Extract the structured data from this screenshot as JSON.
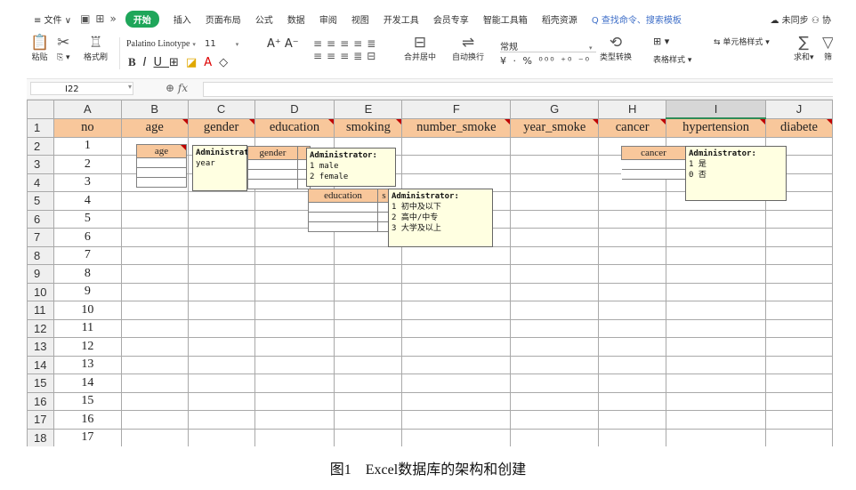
{
  "menu": {
    "file": "≡ 文件 ∨",
    "expand": "»",
    "start": "开始",
    "tabs": [
      "插入",
      "页面布局",
      "公式",
      "数据",
      "审阅",
      "视图",
      "开发工具",
      "会员专享",
      "智能工具箱",
      "稻壳资源"
    ],
    "search": "Q 查找命令、搜索模板",
    "sync": "未同步",
    "collab": "协"
  },
  "ribbon": {
    "paste": "粘贴",
    "format_painter": "格式刷",
    "font_name": "Palatino Linotype",
    "font_size": "11",
    "number_format": "常规",
    "merge_center": "合并居中",
    "wrap_text": "自动换行",
    "type_convert": "类型转换",
    "table_style": "表格样式",
    "cell_style": "单元格样式",
    "sum": "求和",
    "filter": "筛"
  },
  "formula_bar": {
    "cell_ref": "I22",
    "fx": "fx",
    "value": ""
  },
  "grid": {
    "column_letters": [
      "A",
      "B",
      "C",
      "D",
      "E",
      "F",
      "G",
      "H",
      "I",
      "J"
    ],
    "fields": [
      "no",
      "age",
      "gender",
      "education",
      "smoking",
      "number_smoke",
      "year_smoke",
      "cancer",
      "hypertension",
      "diabete"
    ],
    "rows": [
      "1",
      "2",
      "3",
      "4",
      "5",
      "6",
      "7",
      "8",
      "9",
      "10",
      "11",
      "12",
      "13",
      "14",
      "15",
      "16",
      "17"
    ],
    "row_numbers": [
      "1",
      "2",
      "3",
      "4",
      "5",
      "6",
      "7",
      "8",
      "9",
      "10",
      "11",
      "12",
      "13",
      "14",
      "15",
      "16",
      "17",
      "18"
    ],
    "selected_column": "I"
  },
  "mini_tables": {
    "age": "age",
    "gender": "gender",
    "education": "education",
    "cancer": "cancer"
  },
  "comments": {
    "age": {
      "author": "Administrator",
      "lines": [
        "year"
      ]
    },
    "gender": {
      "author": "Administrator:",
      "lines": [
        "1 male",
        "2 female"
      ]
    },
    "education": {
      "author": "Administrator:",
      "lines": [
        "1 初中及以下",
        "2 高中/中专",
        "3 大学及以上"
      ]
    },
    "hypertension": {
      "author": "Administrator:",
      "lines": [
        "1 是",
        "0 否"
      ]
    }
  },
  "caption": "图1　Excel数据库的架构和创建",
  "colors": {
    "header_fill": "#f8c79b",
    "note_fill": "#ffffe1",
    "start_button": "#1fa65a",
    "comment_marker": "#c00000"
  }
}
